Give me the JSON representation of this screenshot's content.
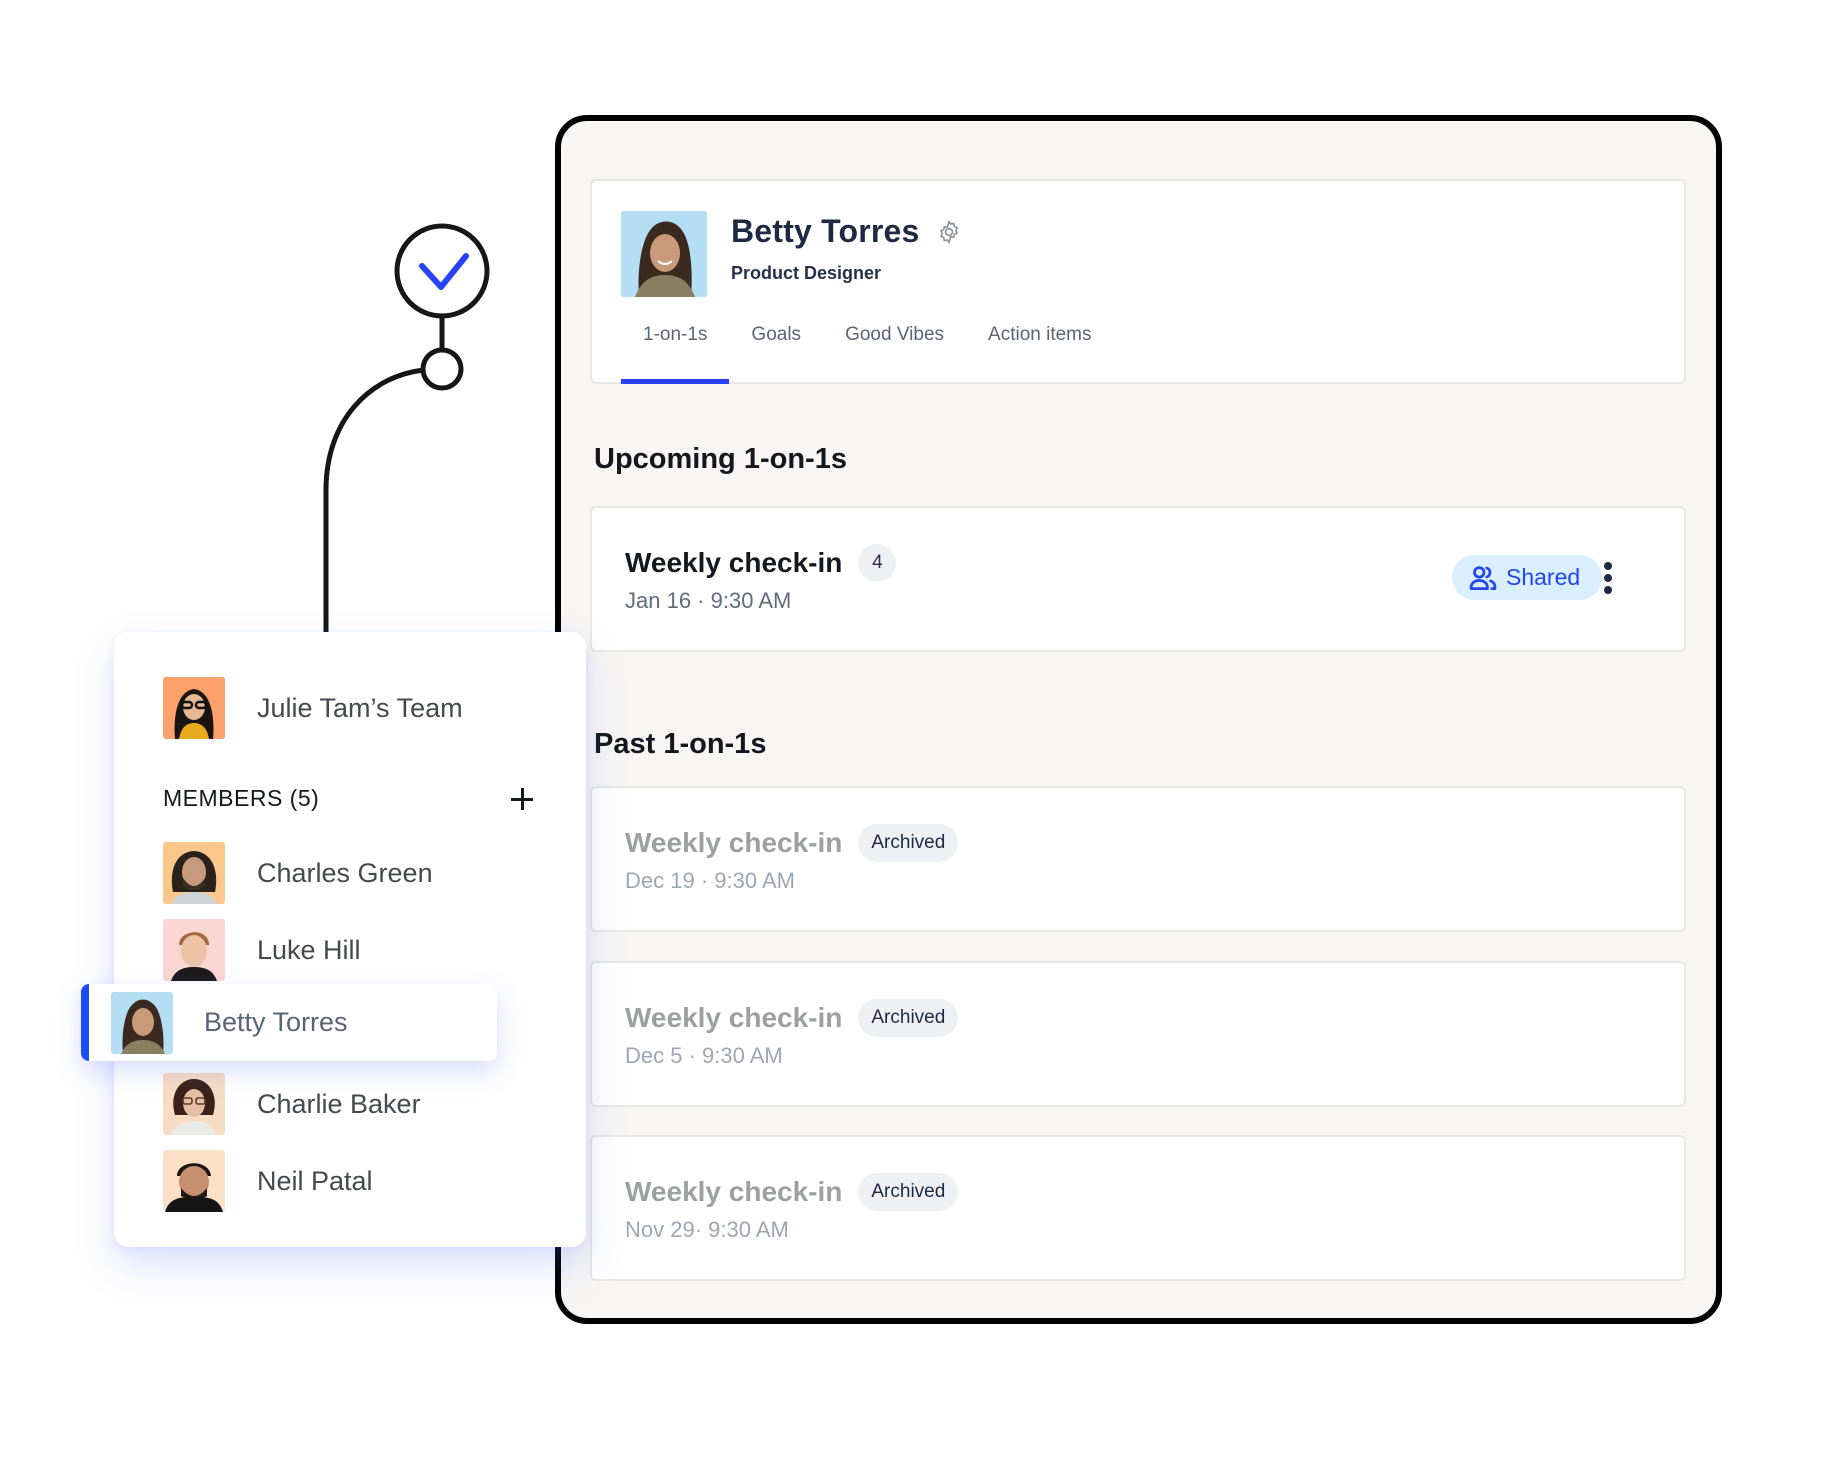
{
  "profile": {
    "name": "Betty Torres",
    "role": "Product Designer",
    "settings_icon": "gear-icon"
  },
  "tabs": [
    {
      "label": "1-on-1s",
      "active": true
    },
    {
      "label": "Goals",
      "active": false
    },
    {
      "label": "Good Vibes",
      "active": false
    },
    {
      "label": "Action items",
      "active": false
    }
  ],
  "upcoming": {
    "title": "Upcoming 1-on-1s",
    "items": [
      {
        "title": "Weekly check-in",
        "count": "4",
        "when": "Jan 16 · 9:30 AM",
        "shared_label": "Shared",
        "shared_icon": "users-icon",
        "menu_icon": "kebab-menu-icon"
      }
    ]
  },
  "past": {
    "title": "Past 1-on-1s",
    "items": [
      {
        "title": "Weekly check-in",
        "badge": "Archived",
        "when": "Dec 19 · 9:30 AM"
      },
      {
        "title": "Weekly check-in",
        "badge": "Archived",
        "when": "Dec 5 · 9:30 AM"
      },
      {
        "title": "Weekly check-in",
        "badge": "Archived",
        "when": "Nov 29· 9:30 AM"
      }
    ]
  },
  "team": {
    "name": "Julie Tam’s Team",
    "members_label": "MEMBERS (5)",
    "add_icon": "plus-icon",
    "members": [
      {
        "name": "Charles Green",
        "selected": false
      },
      {
        "name": "Luke Hill",
        "selected": false
      },
      {
        "name": "Betty Torres",
        "selected": true
      },
      {
        "name": "Charlie Baker",
        "selected": false
      },
      {
        "name": "Neil Patal",
        "selected": false
      }
    ]
  },
  "illustration": {
    "check_icon": "checkmark-icon"
  },
  "colors": {
    "accent": "#2743f5",
    "selected_bar": "#1a4dfa",
    "shared_bg": "#d9effd",
    "frame_bg": "#f7f6f4"
  }
}
